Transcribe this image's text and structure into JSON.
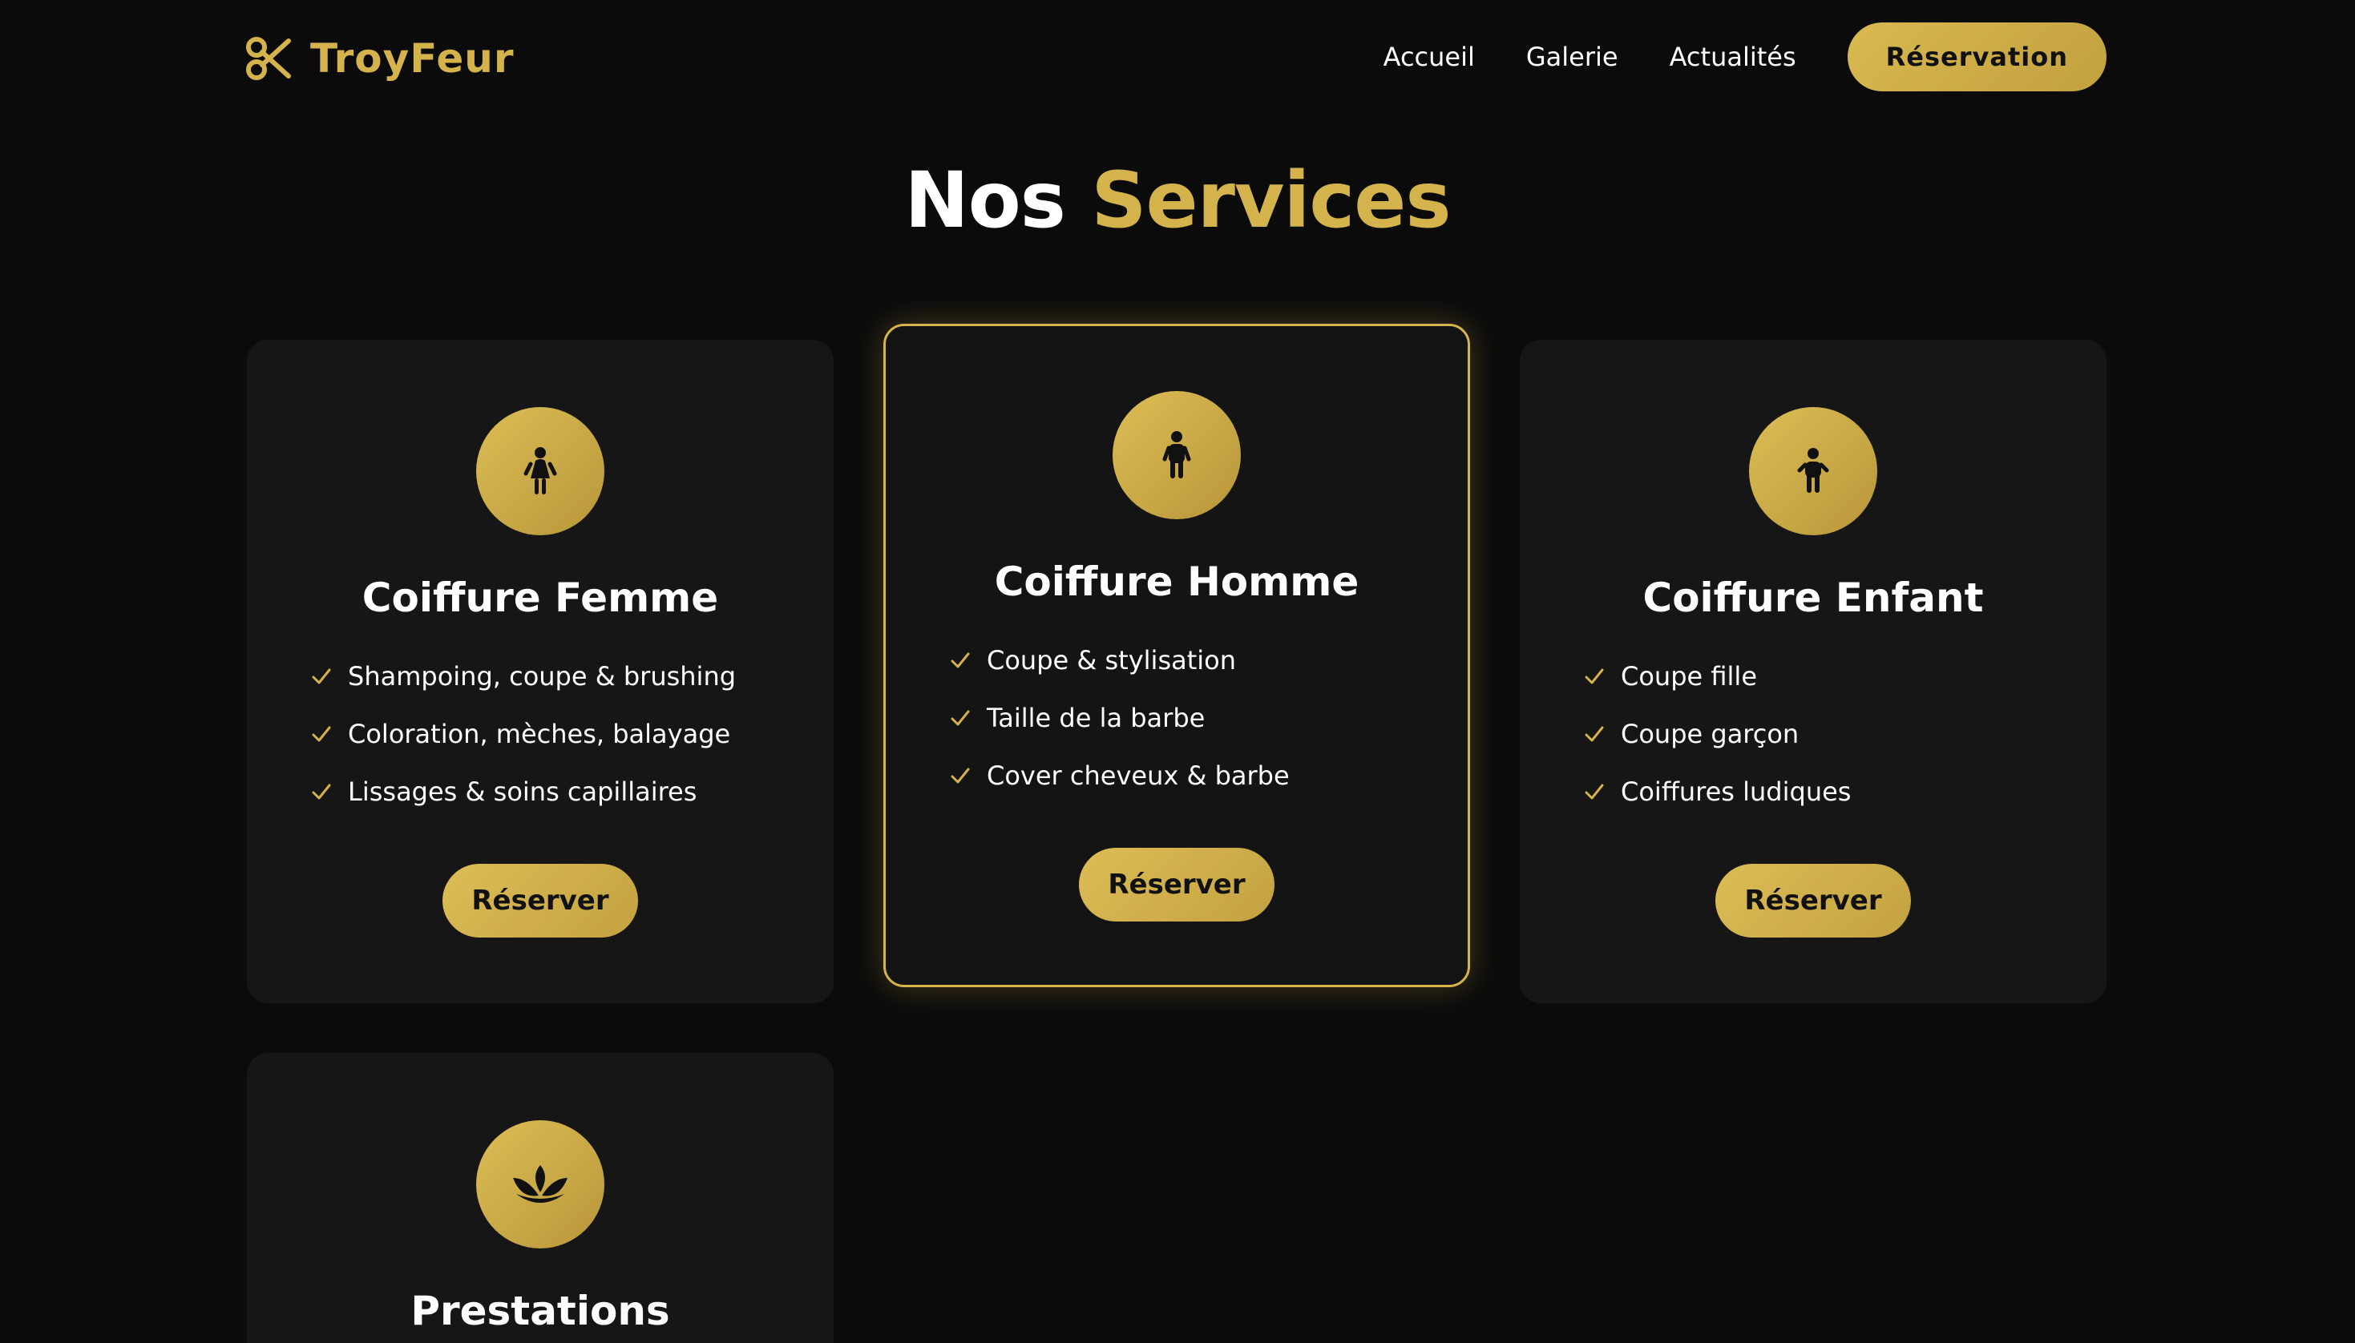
{
  "header": {
    "logo_text": "TroyFeur",
    "nav": [
      {
        "label": "Accueil"
      },
      {
        "label": "Galerie"
      },
      {
        "label": "Actualités"
      }
    ],
    "cta_label": "Réservation"
  },
  "section": {
    "title_part1": "Nos",
    "title_part2": "Services"
  },
  "services": [
    {
      "title": "Coiffure Femme",
      "icon": "woman-icon",
      "features": [
        "Shampoing, coupe & brushing",
        "Coloration, mèches, balayage",
        "Lissages & soins capillaires"
      ],
      "button_label": "Réserver"
    },
    {
      "title": "Coiffure Homme",
      "icon": "man-icon",
      "featured": true,
      "features": [
        "Coupe & stylisation",
        "Taille de la barbe",
        "Cover cheveux & barbe"
      ],
      "button_label": "Réserver"
    },
    {
      "title": "Coiffure Enfant",
      "icon": "child-icon",
      "features": [
        "Coupe fille",
        "Coupe garçon",
        "Coiffures ludiques"
      ],
      "button_label": "Réserver"
    },
    {
      "title": "Prestations",
      "icon": "lotus-icon",
      "features": [],
      "button_label": ""
    }
  ],
  "colors": {
    "accent": "#d4b24c",
    "background": "#0b0b0b",
    "card": "#161616"
  }
}
